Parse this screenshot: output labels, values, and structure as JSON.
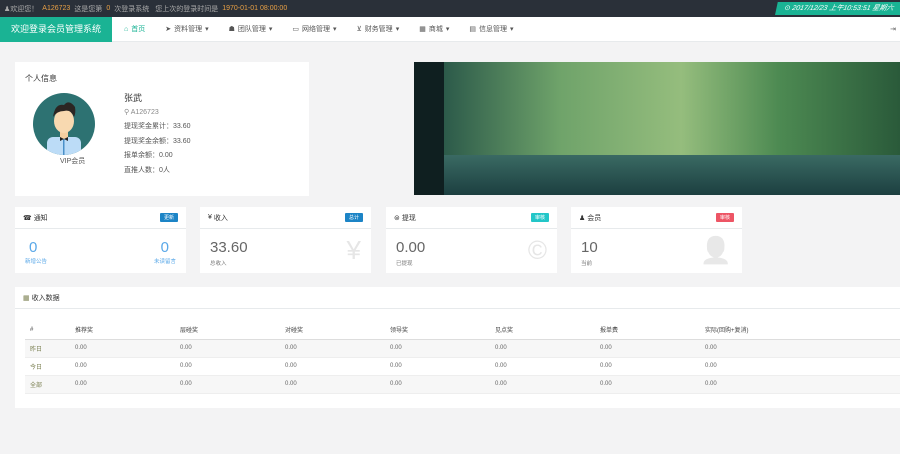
{
  "topbar": {
    "welcome": "欢迎您！",
    "user": "A126723",
    "login_prefix": "这是您第",
    "login_count": "0",
    "login_suffix": "次登录系统",
    "last_label": "您上次的登录时间是",
    "last_time": "1970-01-01 08:00:00",
    "clock": "2017/12/23 上午10:53:51 星期六"
  },
  "nav": {
    "brand": "欢迎登录会员管理系统",
    "items": [
      "首页",
      "资料管理",
      "团队管理",
      "网络管理",
      "财务管理",
      "商城",
      "信息管理"
    ]
  },
  "profile": {
    "title": "个人信息",
    "name": "张武",
    "id": "A126723",
    "level": "VIP会员",
    "lines": [
      "提现奖金累计：33.60",
      "提现奖金余额：33.60",
      "报单余额：0.00",
      "直推人数：0人"
    ]
  },
  "cards": [
    {
      "title": "通知",
      "badge": "更新",
      "badge_color": "#1c84c6",
      "stats": [
        {
          "value": "0",
          "label": "新增公告"
        },
        {
          "value": "0",
          "label": "未读留言"
        }
      ]
    },
    {
      "title": "收入",
      "badge": "总计",
      "badge_color": "#1c84c6",
      "value": "33.60",
      "label": "总收入",
      "bg": "¥"
    },
    {
      "title": "提现",
      "badge": "审核",
      "badge_color": "#23c6c8",
      "value": "0.00",
      "label": "已提现",
      "bg": "©"
    },
    {
      "title": "会员",
      "badge": "审核",
      "badge_color": "#ed5565",
      "value": "10",
      "label": "当前",
      "bg": "👤"
    }
  ],
  "income": {
    "title": "收入数据",
    "headers": [
      "#",
      "推荐奖",
      "层碰奖",
      "对碰奖",
      "领导奖",
      "见点奖",
      "报单费",
      "实际(回购+复消)"
    ],
    "rows": [
      [
        "昨日",
        "0.00",
        "0.00",
        "0.00",
        "0.00",
        "0.00",
        "0.00",
        "0.00"
      ],
      [
        "今日",
        "0.00",
        "0.00",
        "0.00",
        "0.00",
        "0.00",
        "0.00",
        "0.00"
      ],
      [
        "全部",
        "0.00",
        "0.00",
        "0.00",
        "0.00",
        "0.00",
        "0.00",
        "0.00"
      ]
    ]
  }
}
